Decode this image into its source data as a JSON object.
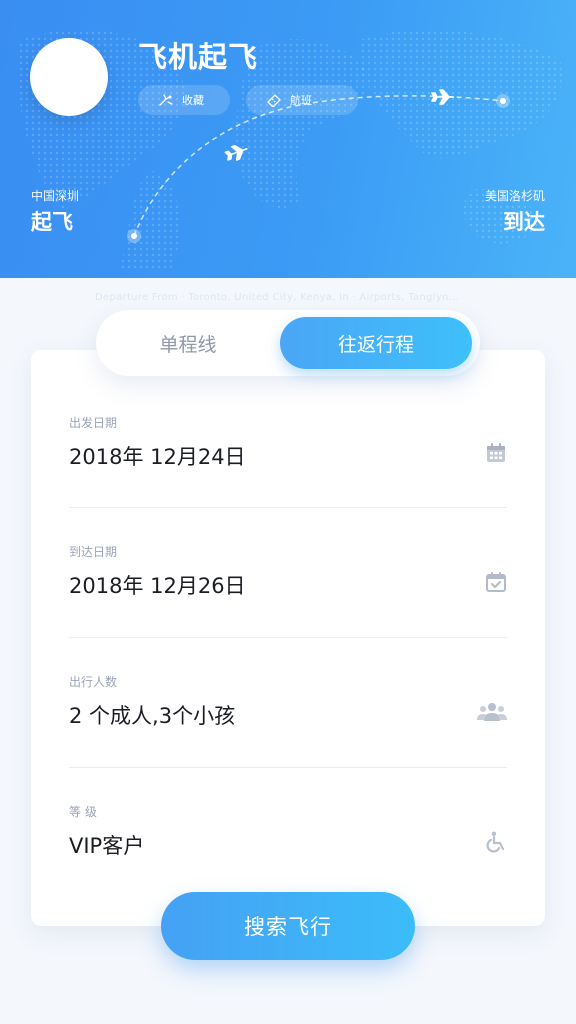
{
  "header": {
    "title": "飞机起飞",
    "favorite_label": "收藏",
    "flight_label": "航班",
    "origin": {
      "country": "中国深圳",
      "label": "起飞"
    },
    "destination": {
      "country": "美国洛杉矶",
      "label": "到达"
    }
  },
  "subtitle": "Departure From · Toronto, United City, Kenya, in · Airports, Tanglyn...",
  "trip_toggle": {
    "one_way": "单程线",
    "round_trip": "往返行程",
    "selected": "round_trip"
  },
  "form": {
    "departure_date": {
      "label": "出发日期",
      "value": "2018年 12月24日",
      "icon": "calendar-icon"
    },
    "arrival_date": {
      "label": "到达日期",
      "value": "2018年 12月26日",
      "icon": "calendar-check-icon"
    },
    "passengers": {
      "label": "出行人数",
      "value": "2 个成人,3个小孩",
      "icon": "people-icon"
    },
    "class": {
      "label": "等 级",
      "value": "VIP客户",
      "icon": "accessibility-icon"
    }
  },
  "search_button": "搜索飞行",
  "colors": {
    "primary": "#3b9bf5",
    "accent": "#3ec0fa",
    "label": "#9aa4b8",
    "text": "#1b1d24"
  }
}
